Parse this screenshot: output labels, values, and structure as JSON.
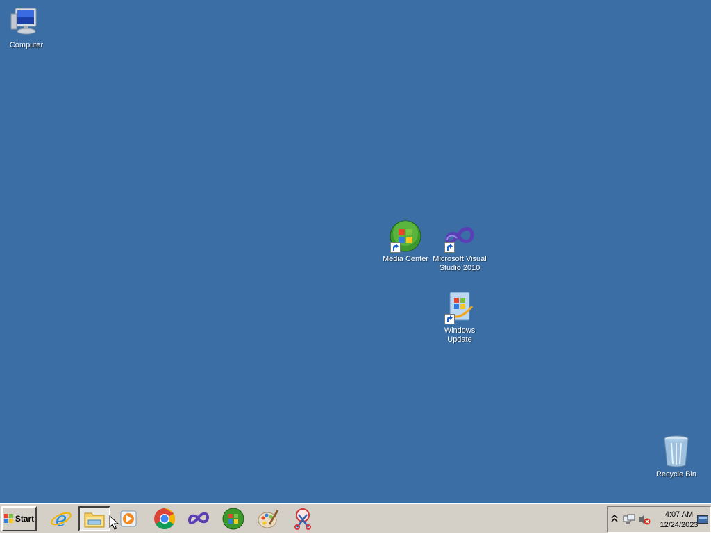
{
  "desktop": {
    "background": "#3a6ea5",
    "icons": [
      {
        "label": "Computer",
        "icon": "computer-icon"
      },
      {
        "label": "Media Center",
        "icon": "media-center-icon"
      },
      {
        "label": "Microsoft Visual Studio 2010",
        "icon": "visual-studio-icon"
      },
      {
        "label": "Windows Update",
        "icon": "windows-update-icon"
      },
      {
        "label": "Recycle Bin",
        "icon": "recycle-bin-icon"
      }
    ]
  },
  "taskbar": {
    "start_label": "Start",
    "pinned": [
      {
        "icon": "internet-explorer-icon"
      },
      {
        "icon": "file-explorer-icon",
        "active": true
      },
      {
        "icon": "media-player-icon"
      },
      {
        "icon": "chrome-icon"
      },
      {
        "icon": "visual-studio-icon"
      },
      {
        "icon": "media-center-icon"
      },
      {
        "icon": "paint-icon"
      },
      {
        "icon": "snipping-tool-icon"
      }
    ],
    "tray": {
      "clock_time": "4:07 AM",
      "clock_date": "12/24/2023",
      "icons": [
        "show-hidden-icons",
        "network-icon",
        "volume-muted-icon",
        "show-desktop-icon"
      ]
    }
  }
}
